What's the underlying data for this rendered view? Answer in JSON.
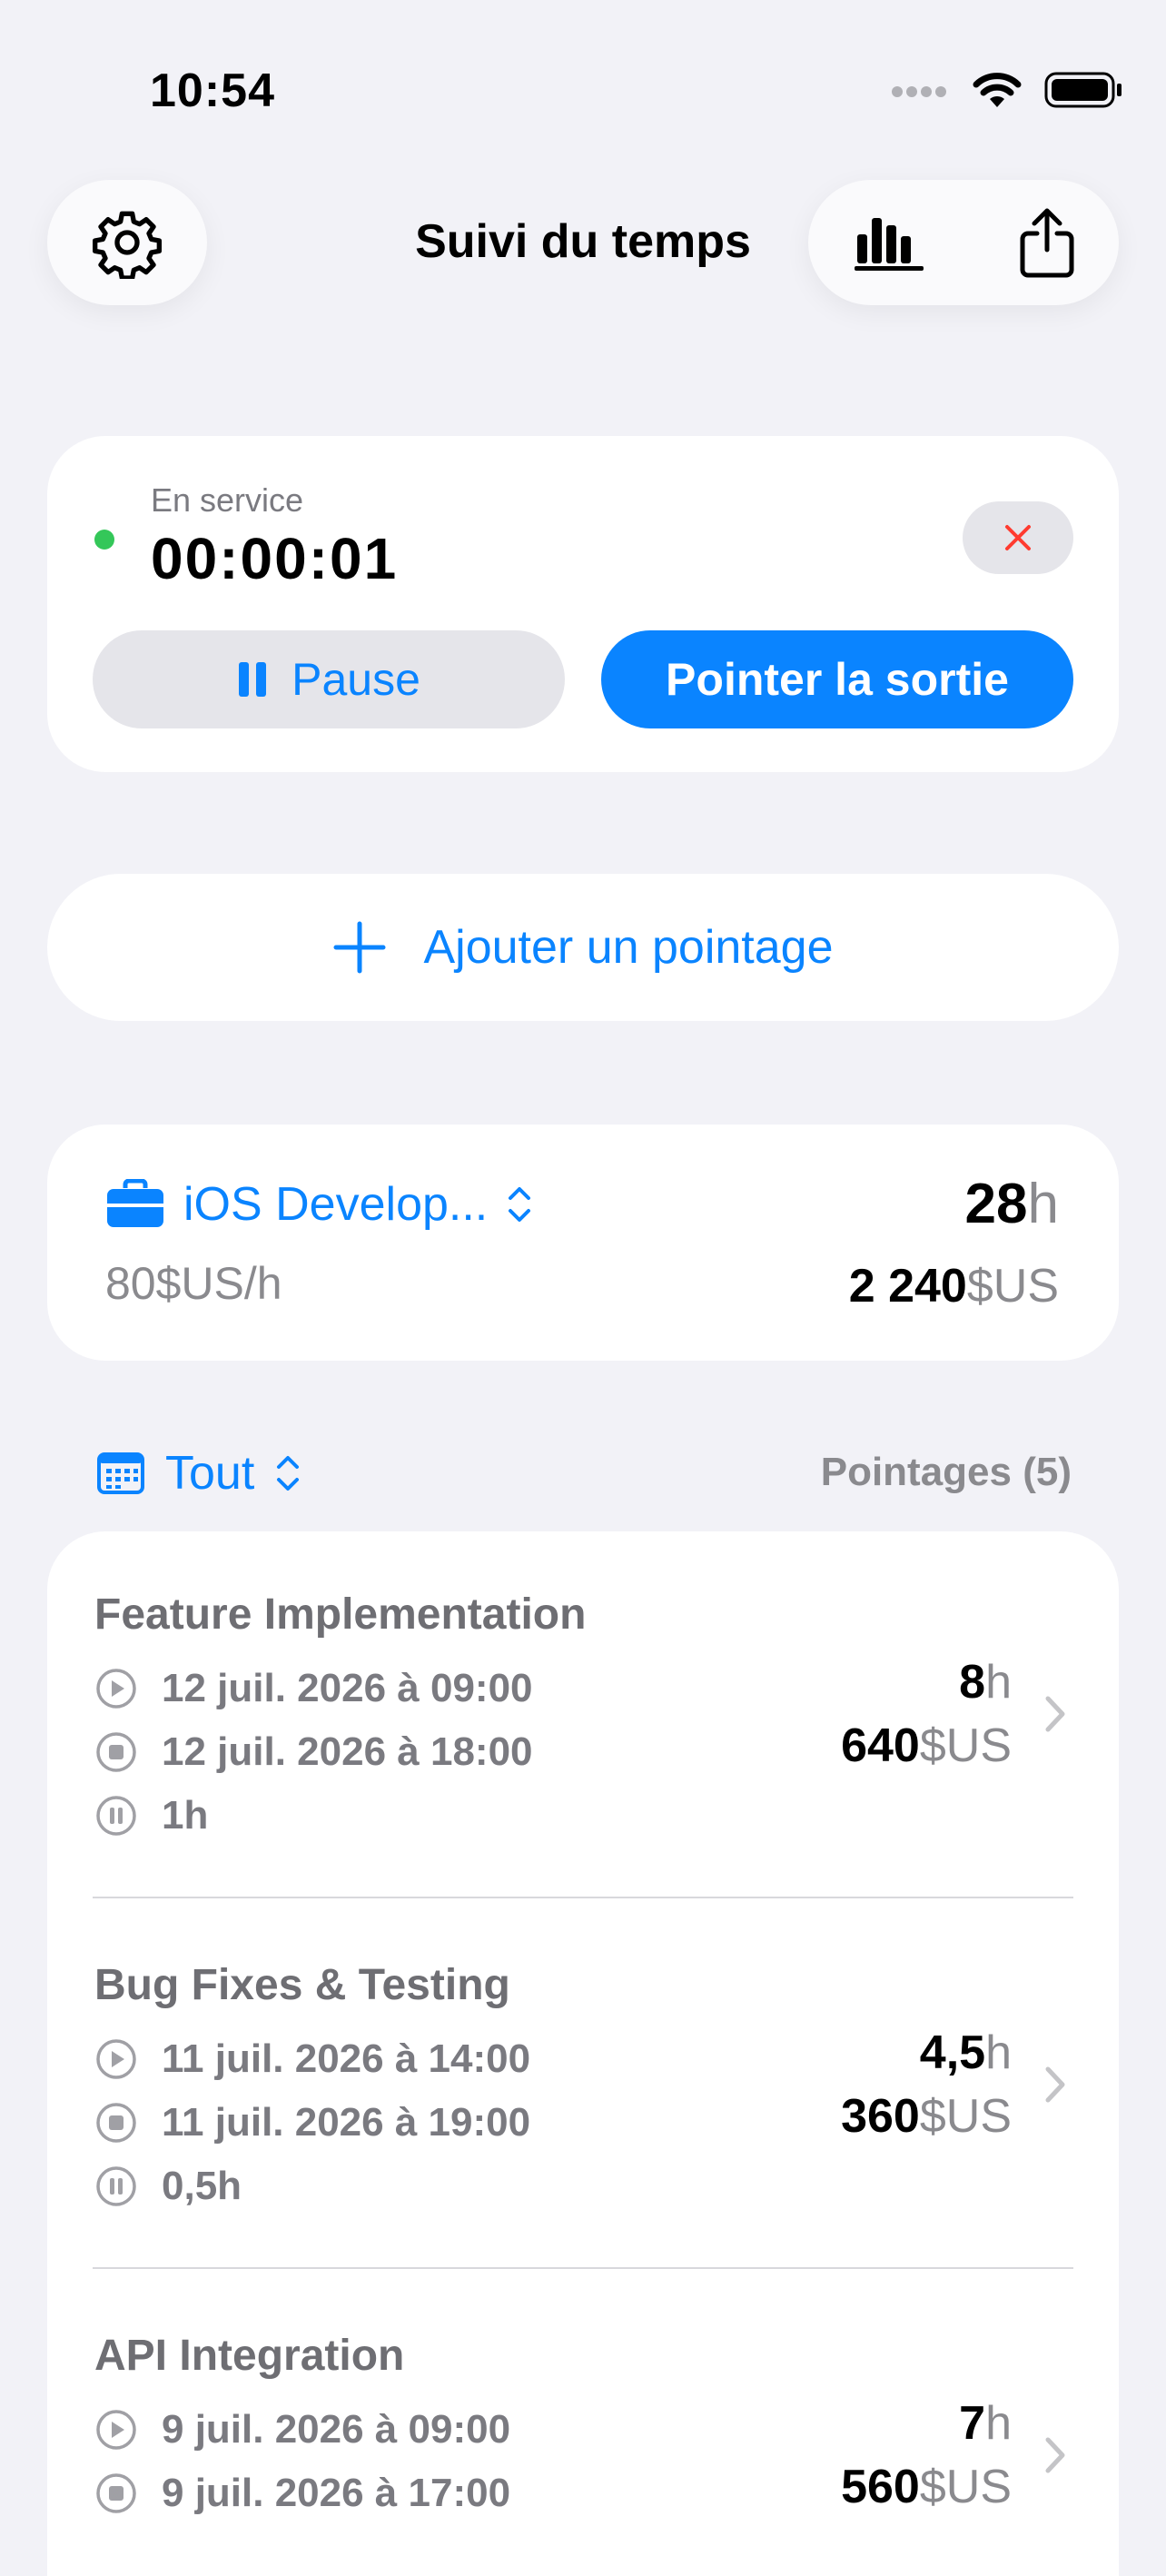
{
  "status_bar": {
    "time": "10:54"
  },
  "nav": {
    "title": "Suivi du temps"
  },
  "timer": {
    "status_label": "En service",
    "elapsed": "00:00:01",
    "pause_label": "Pause",
    "clock_out_label": "Pointer la sortie",
    "status_color": "#34C759"
  },
  "add_entry": {
    "label": "Ajouter un pointage"
  },
  "project": {
    "name": "iOS Develop...",
    "rate": "80$US/h",
    "total_hours_value": "28",
    "total_hours_unit": "h",
    "total_amount_value": "2 240",
    "total_amount_unit": "$US"
  },
  "filter": {
    "label": "Tout",
    "entries_count": "Pointages (5)"
  },
  "entries": [
    {
      "title": "Feature Implementation",
      "start": "12 juil. 2026 à 09:00",
      "end": "12 juil. 2026 à 18:00",
      "break": "1h",
      "hours_value": "8",
      "hours_unit": "h",
      "amount_value": "640",
      "amount_unit": "$US"
    },
    {
      "title": "Bug Fixes & Testing",
      "start": "11 juil. 2026 à 14:00",
      "end": "11 juil. 2026 à 19:00",
      "break": "0,5h",
      "hours_value": "4,5",
      "hours_unit": "h",
      "amount_value": "360",
      "amount_unit": "$US"
    },
    {
      "title": "API Integration",
      "start": "9 juil. 2026 à 09:00",
      "end": "9 juil. 2026 à 17:00",
      "break": "",
      "hours_value": "7",
      "hours_unit": "h",
      "amount_value": "560",
      "amount_unit": "$US"
    }
  ],
  "colors": {
    "accent": "#0A84FF",
    "background": "#F2F2F7",
    "destructive": "#FF3B30"
  }
}
